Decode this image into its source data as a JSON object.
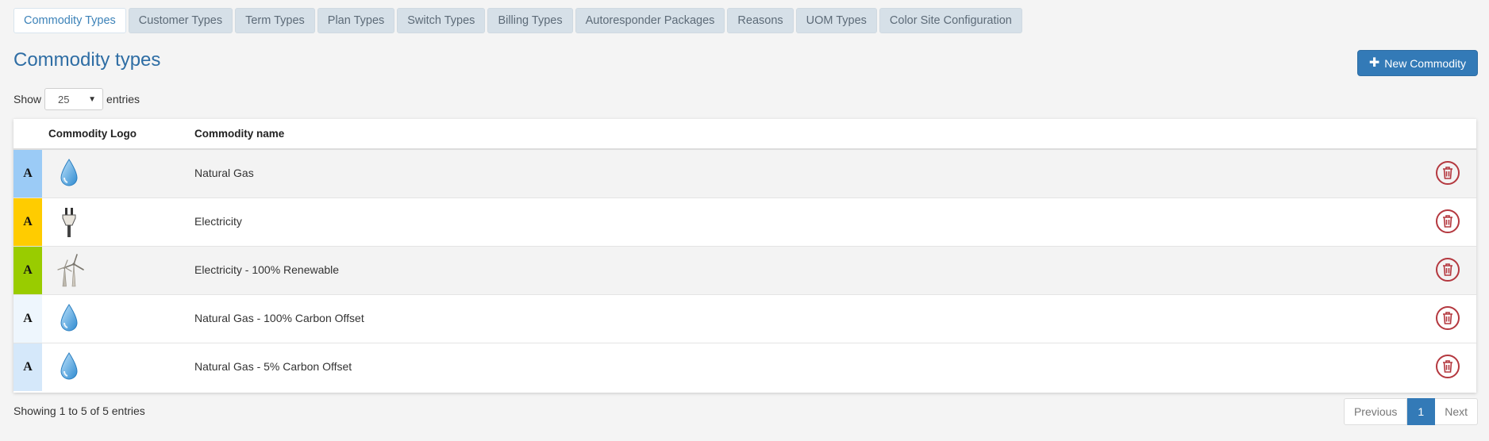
{
  "tabs": [
    {
      "label": "Commodity Types",
      "active": true
    },
    {
      "label": "Customer Types"
    },
    {
      "label": "Term Types"
    },
    {
      "label": "Plan Types"
    },
    {
      "label": "Switch Types"
    },
    {
      "label": "Billing Types"
    },
    {
      "label": "Autoresponder Packages"
    },
    {
      "label": "Reasons"
    },
    {
      "label": "UOM Types"
    },
    {
      "label": "Color Site Configuration"
    }
  ],
  "page": {
    "title": "Commodity types",
    "new_button_label": "New Commodity",
    "new_button_icon": "plus-icon"
  },
  "length_control": {
    "show_label": "Show",
    "selected": "25",
    "entries_label": "entries"
  },
  "table": {
    "columns": [
      "Commodity Logo",
      "Commodity name"
    ],
    "rows": [
      {
        "letter": "A",
        "color": "#9bcbf6",
        "logo": "water-drop-icon",
        "name": "Natural Gas"
      },
      {
        "letter": "A",
        "color": "#ffcc00",
        "logo": "electric-plug-icon",
        "name": "Electricity"
      },
      {
        "letter": "A",
        "color": "#99cc00",
        "logo": "wind-turbine-icon",
        "name": "Electricity - 100% Renewable"
      },
      {
        "letter": "A",
        "color": "#eef6fd",
        "logo": "water-drop-icon",
        "name": "Natural Gas - 100% Carbon Offset"
      },
      {
        "letter": "A",
        "color": "#d5e8fa",
        "logo": "water-drop-icon",
        "name": "Natural Gas - 5% Carbon Offset"
      }
    ],
    "delete_icon": "trash-icon"
  },
  "footer": {
    "info": "Showing 1 to 5 of 5 entries",
    "prev_label": "Previous",
    "page": "1",
    "next_label": "Next"
  },
  "colors": {
    "accent": "#337ab7",
    "title": "#2e6da4",
    "tab_bg": "#d6e0e8",
    "delete": "#b4383f"
  }
}
